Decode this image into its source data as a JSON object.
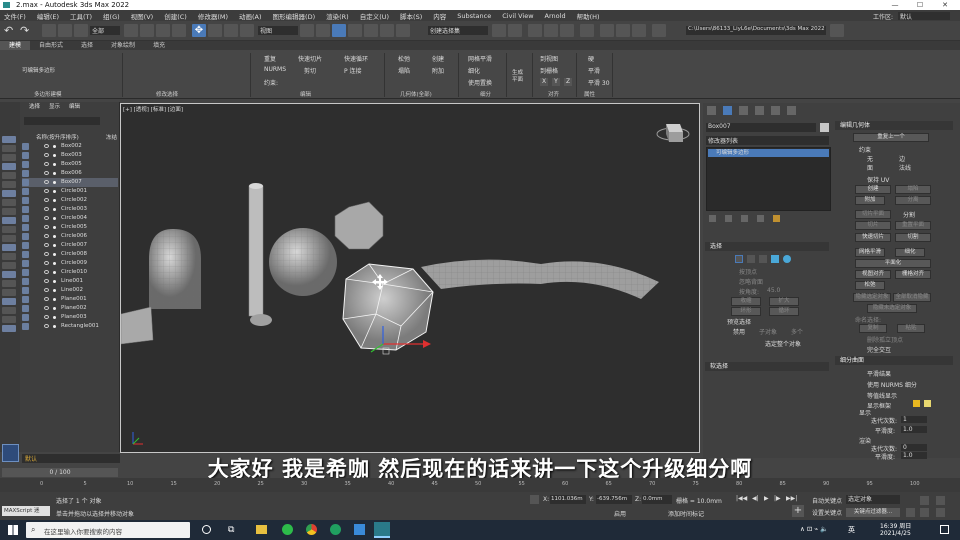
{
  "window": {
    "title": "2.max - Autodesk 3ds Max 2022"
  },
  "menu": {
    "items": [
      "文件(F)",
      "编辑(E)",
      "工具(T)",
      "组(G)",
      "视图(V)",
      "创建(C)",
      "修改器(M)",
      "动画(A)",
      "图形编辑器(D)",
      "渲染(R)",
      "自定义(U)",
      "脚本(S)",
      "内容",
      "Substance",
      "Civil View",
      "Arnold",
      "帮助(H)"
    ],
    "workspace_label": "工作区:",
    "workspace_value": "默认"
  },
  "toolbar": {
    "filter_value": "全部",
    "refcoord_value": "视图",
    "selection_set": "创建选择集",
    "path": "C:\\Users\\86133_LiyL6e\\Documents\\3ds Max 2022"
  },
  "ribbon": {
    "tabs": [
      "建模",
      "自由形式",
      "选择",
      "对象绘制",
      "填充"
    ],
    "modeling_label": "多边形建模",
    "modify_label": "修改选择",
    "editable_poly_label": "可编辑多边形",
    "edit_group": {
      "label": "编辑",
      "items": [
        "重复",
        "快速切片",
        "快速循环",
        "NURMS",
        "剪切",
        "P 连接",
        "约束:"
      ]
    },
    "geometry_group": {
      "label": "几何体(全部)",
      "items": [
        "松弛",
        "创建",
        "塌陷",
        "附加"
      ]
    },
    "subdivide_group": {
      "label": "细分",
      "items": [
        "网格平滑",
        "细化",
        "使用置换"
      ]
    },
    "generate_label": "生成\n平面",
    "align_group": {
      "label": "对齐",
      "items": [
        "到视图",
        "到栅格",
        "X",
        "Y",
        "Z"
      ]
    },
    "properties_group": {
      "label": "属性",
      "items": [
        "硬",
        "平滑",
        "平滑 30"
      ]
    }
  },
  "scene_explorer": {
    "tabs": [
      "选择",
      "显示",
      "编辑"
    ],
    "header_name": "名称(按升序排序)",
    "header_frozen": "冻结",
    "objects": [
      "Box002",
      "Box003",
      "Box005",
      "Box006",
      "Box007",
      "Circle001",
      "Circle002",
      "Circle003",
      "Circle004",
      "Circle005",
      "Circle006",
      "Circle007",
      "Circle008",
      "Circle009",
      "Circle010",
      "Line001",
      "Line002",
      "Plane001",
      "Plane002",
      "Plane003",
      "Rectangle001"
    ],
    "selected": "Box007",
    "layer_label": "默认"
  },
  "viewport": {
    "label": "[+] [透视] [标准] [边面]"
  },
  "command_panel": {
    "object_name": "Box007",
    "modifier_list": "修改器列表",
    "stack_item": "可编辑多边形",
    "selection_rollout": "选择",
    "by_vertex": "按顶点",
    "ignore_backfacing": "忽略背面",
    "by_angle": "按角度:",
    "angle_value": "45.0",
    "shrink": "收缩",
    "grow": "扩大",
    "ring": "环形",
    "loop": "循环",
    "preview_selection": "预览选择",
    "disabled": "禁用",
    "subobject": "子对象",
    "multi": "多个",
    "selected_whole": "选定整个对象",
    "soft_selection": "软选择",
    "edit_geometry": "编辑几何体",
    "repeat_last": "重复上一个",
    "constraints": "约束",
    "c_none": "无",
    "c_edge": "边",
    "c_face": "面",
    "c_normal": "法线",
    "preserve_uv": "保持 UV",
    "create": "创建",
    "collapse": "塌陷",
    "attach": "附加",
    "detach": "分离",
    "slice_plane": "切片平面",
    "split": "分割",
    "slice": "切片",
    "reset_plane": "重置平面",
    "quickslice": "快速切片",
    "cut": "切割",
    "meshsmooth": "网格平滑",
    "tessellate": "细化",
    "planarize": "平面化",
    "make_planar": "视图对齐",
    "grid_align": "栅格对齐",
    "relax": "松弛",
    "hide_selected": "隐藏选定对象",
    "unhide_all": "全部取消隐藏",
    "hide_unselected": "隐藏未选定对象",
    "named_selections": "命名选择:",
    "copy": "复制",
    "paste": "粘贴",
    "delete_isolated": "删除孤立顶点",
    "full_interactivity": "完全交互",
    "subdivision_surface": "细分曲面",
    "smooth_result": "平滑结果",
    "use_nurms": "使用 NURMS 细分",
    "isoline_display": "等值线显示",
    "show_cage": "显示框架",
    "display": "显示",
    "iterations": "迭代次数:",
    "iter_value": "1",
    "smoothness": "平滑度:",
    "smooth_value": "1.0",
    "render": "渲染",
    "iter_value2": "0",
    "smooth_value2": "1.0"
  },
  "subtitle": "大家好 我是希咖 然后现在的话来讲一下这个升级细分啊",
  "timeline": {
    "frame": "0 / 100",
    "ticks": [
      "0",
      "5",
      "10",
      "15",
      "20",
      "25",
      "30",
      "35",
      "40",
      "45",
      "50",
      "55",
      "60",
      "65",
      "70",
      "75",
      "80",
      "85",
      "90",
      "95",
      "100"
    ]
  },
  "status": {
    "maxscript": "MAXScript 迷",
    "selected": "选择了 1 个 对象",
    "hint": "单击并拖动以选择并移动对象",
    "x": "1101.036m",
    "y": "-639.756m",
    "z": "0.0mm",
    "grid": "栅格 = 10.0mm",
    "enable": "启用",
    "add_time_tag": "添加时间标记",
    "autokey": "自动关键点",
    "selected_objects": "选定对象",
    "setkey": "设置关键点",
    "keyfilter": "关键点过滤器..."
  },
  "taskbar": {
    "search": "在这里输入你要搜索的内容",
    "time": "16:39 周日",
    "date": "2021/4/25",
    "ime": "英"
  },
  "colors": {
    "accent": "#5b9bd5",
    "selection": "#4a7ab8"
  }
}
